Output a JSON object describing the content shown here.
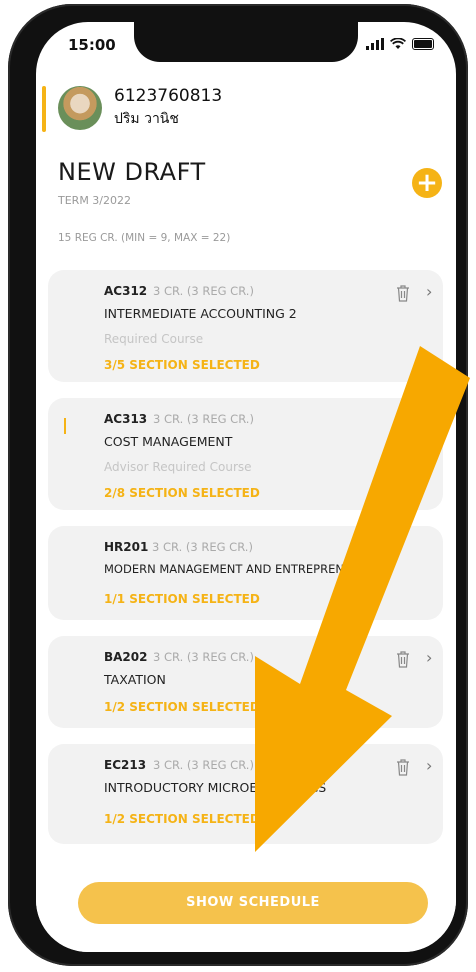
{
  "status_bar": {
    "time": "15:00"
  },
  "profile": {
    "student_id": "6123760813",
    "name": "ปริม วานิช"
  },
  "draft": {
    "title": "NEW DRAFT",
    "term": "TERM 3/2022",
    "credits": "15 REG CR. (MIN = 9, MAX = 22)",
    "add_icon": "plus-icon"
  },
  "courses": [
    {
      "code": "AC312",
      "credit": "3 CR. (3 REG CR.)",
      "name": "INTERMEDIATE ACCOUNTING 2",
      "requirement": "Required Course",
      "sections": "3/5 SECTION SELECTED"
    },
    {
      "code": "AC313",
      "credit": "3 CR. (3 REG CR.)",
      "name": "COST MANAGEMENT",
      "requirement": "Advisor Required Course",
      "sections": "2/8 SECTION SELECTED"
    },
    {
      "code": "HR201",
      "credit": "3 CR. (3 REG CR.)",
      "name": "MODERN MANAGEMENT AND ENTREPRENEURSHIP",
      "requirement": "",
      "sections": "1/1 SECTION SELECTED"
    },
    {
      "code": "BA202",
      "credit": "3 CR. (3 REG CR.)",
      "name": "TAXATION",
      "requirement": "",
      "sections": "1/2 SECTION SELECTED"
    },
    {
      "code": "EC213",
      "credit": "3 CR. (3 REG CR.)",
      "name": "INTRODUCTORY MICROECONOMICS",
      "requirement": "",
      "sections": "1/2 SECTION SELECTED"
    }
  ],
  "actions": {
    "show_schedule": "SHOW SCHEDULE"
  },
  "colors": {
    "accent": "#f5b316",
    "arrow": "#f7a800",
    "card_bg": "#f2f2f2"
  }
}
